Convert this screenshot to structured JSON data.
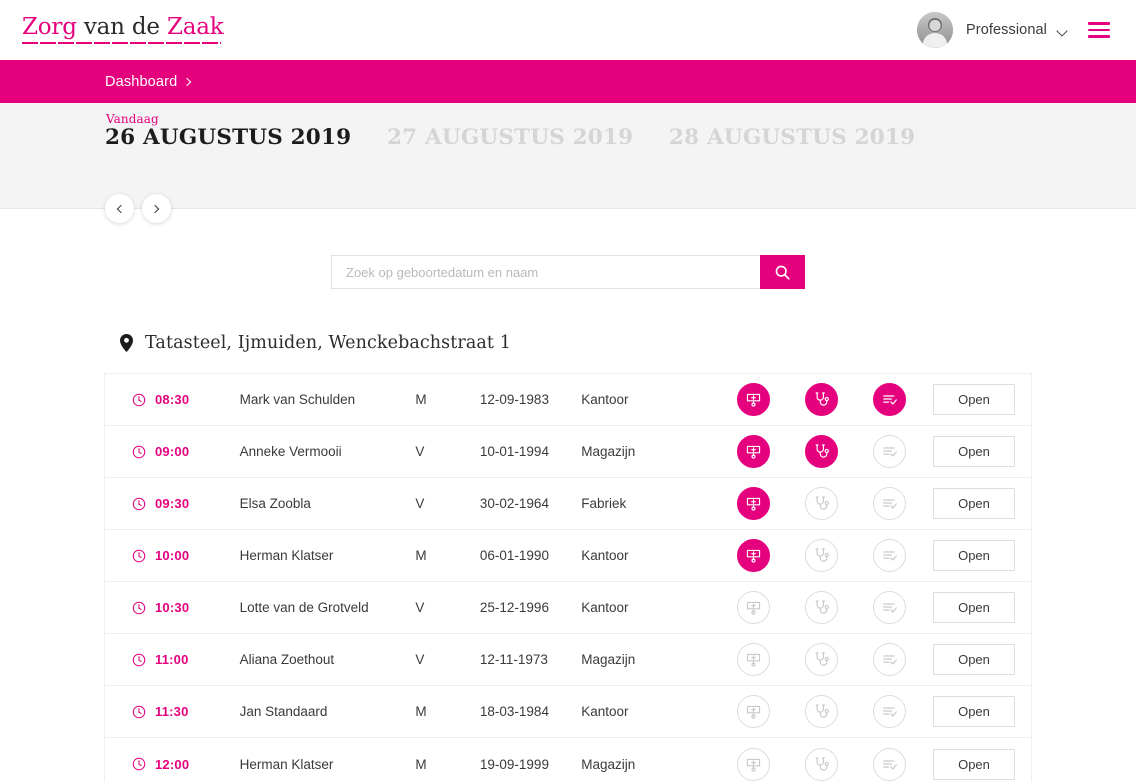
{
  "brand": {
    "logo_part1": "Zorg",
    "logo_part2": " van de ",
    "logo_part3": "Zaak",
    "accent_color": "#e5007d"
  },
  "header": {
    "user_label": "Professional",
    "chevron_icon": "chevron-down-icon",
    "menu_icon": "hamburger-menu-icon",
    "avatar_icon": "user-avatar-photo"
  },
  "breadcrumb": {
    "label": "Dashboard",
    "arrow_icon": "chevron-right-icon"
  },
  "date_strip": {
    "today_tag": "Vandaag",
    "dates": [
      {
        "label": "26 AUGUSTUS 2019",
        "active": true
      },
      {
        "label": "27 AUGUSTUS 2019",
        "active": false
      },
      {
        "label": "28 AUGUSTUS 2019",
        "active": false
      }
    ],
    "prev_icon": "chevron-left-icon",
    "next_icon": "chevron-right-icon"
  },
  "search": {
    "value": "",
    "placeholder": "Zoek op geboortedatum en naam",
    "button_icon": "search-icon"
  },
  "location": {
    "pin_icon": "map-pin-icon",
    "label": "Tatasteel, Ijmuiden, Wenckebachstraat 1"
  },
  "appointments": {
    "open_label": "Open",
    "icon_names": [
      "screening-icon",
      "stethoscope-icon",
      "checklist-icon"
    ],
    "rows": [
      {
        "time": "08:30",
        "name": "Mark van Schulden",
        "gender": "M",
        "dob": "12-09-1983",
        "dept": "Kantoor",
        "icons": [
          true,
          true,
          true
        ],
        "open": "Open"
      },
      {
        "time": "09:00",
        "name": "Anneke Vermooii",
        "gender": "V",
        "dob": "10-01-1994",
        "dept": "Magazijn",
        "icons": [
          true,
          true,
          false
        ],
        "open": "Open"
      },
      {
        "time": "09:30",
        "name": "Elsa Zoobla",
        "gender": "V",
        "dob": "30-02-1964",
        "dept": "Fabriek",
        "icons": [
          true,
          false,
          false
        ],
        "open": "Open"
      },
      {
        "time": "10:00",
        "name": "Herman Klatser",
        "gender": "M",
        "dob": "06-01-1990",
        "dept": "Kantoor",
        "icons": [
          true,
          false,
          false
        ],
        "open": "Open"
      },
      {
        "time": "10:30",
        "name": "Lotte van de Grotveld",
        "gender": "V",
        "dob": "25-12-1996",
        "dept": "Kantoor",
        "icons": [
          false,
          false,
          false
        ],
        "open": "Open"
      },
      {
        "time": "11:00",
        "name": "Aliana Zoethout",
        "gender": "V",
        "dob": "12-11-1973",
        "dept": "Magazijn",
        "icons": [
          false,
          false,
          false
        ],
        "open": "Open"
      },
      {
        "time": "11:30",
        "name": "Jan Standaard",
        "gender": "M",
        "dob": "18-03-1984",
        "dept": "Kantoor",
        "icons": [
          false,
          false,
          false
        ],
        "open": "Open"
      },
      {
        "time": "12:00",
        "name": "Herman Klatser",
        "gender": "M",
        "dob": "19-09-1999",
        "dept": "Magazijn",
        "icons": [
          false,
          false,
          false
        ],
        "open": "Open"
      }
    ]
  }
}
